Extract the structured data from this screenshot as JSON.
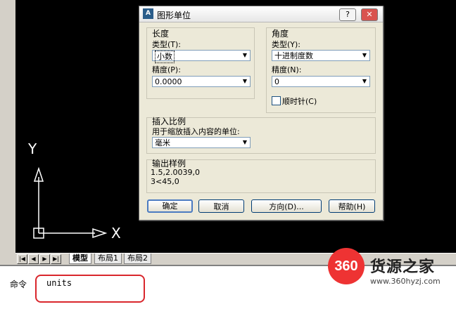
{
  "dialog": {
    "title": "图形单位",
    "app_icon_text": "A",
    "help_button": "?",
    "close_button": "✕",
    "length": {
      "group_label": "长度",
      "type_label": "类型(T):",
      "type_value": "小数",
      "precision_label": "精度(P):",
      "precision_value": "0.0000"
    },
    "angle": {
      "group_label": "角度",
      "type_label": "类型(Y):",
      "type_value": "十进制度数",
      "precision_label": "精度(N):",
      "precision_value": "0",
      "clockwise_label": "顺时针(C)",
      "clockwise_checked": false
    },
    "insert_scale": {
      "group_label": "插入比例",
      "desc": "用于缩放插入内容的单位:",
      "value": "毫米"
    },
    "sample": {
      "group_label": "输出样例",
      "line1": "1.5,2.0039,0",
      "line2": "3<45,0"
    },
    "buttons": {
      "ok": "确定",
      "cancel": "取消",
      "direction": "方向(D)...",
      "help": "帮助(H)"
    }
  },
  "ucs": {
    "x_label": "X",
    "y_label": "Y"
  },
  "tabs": {
    "items": [
      "模型",
      "布局1",
      "布局2"
    ]
  },
  "command": {
    "prompt": "命令",
    "text": "units"
  },
  "watermark": {
    "logo": "360",
    "name": "货源之家",
    "url": "www.360hyzj.com"
  },
  "colors": {
    "canvas": "#000000",
    "highlight": "#d9262c"
  }
}
